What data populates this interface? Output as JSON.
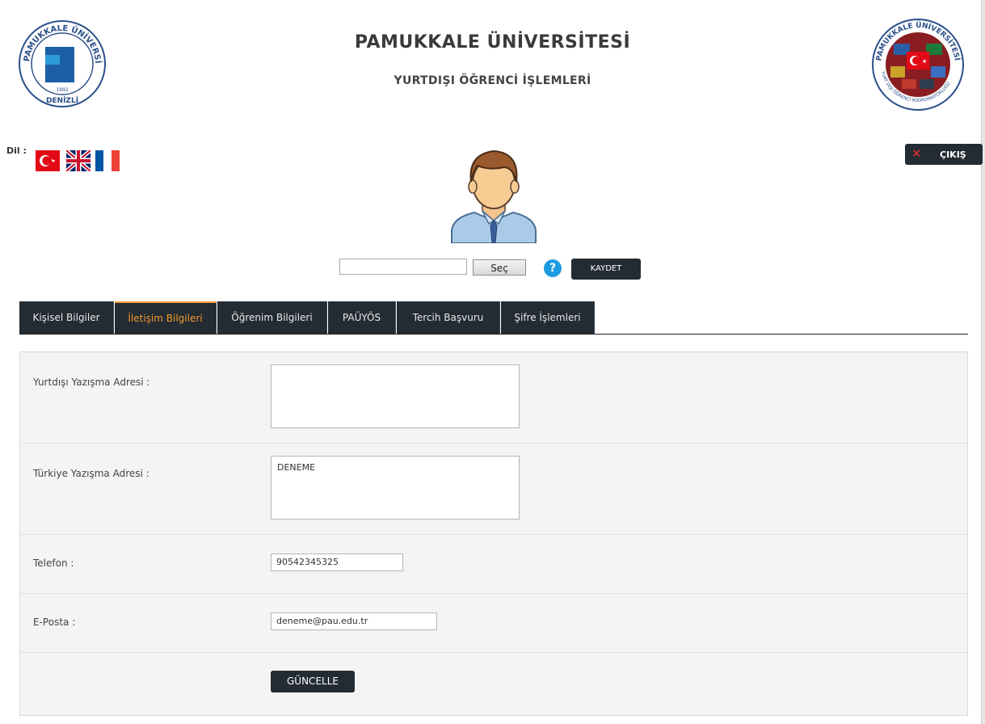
{
  "header": {
    "university_name": "PAMUKKALE ÜNİVERSİTESİ",
    "department": "YURTDIŞI ÖĞRENCİ İŞLEMLERİ",
    "left_logo": {
      "ring_text": "PAMUKKALE ÜNİVERSİTESİ",
      "year": "1992",
      "city": "DENİZLİ"
    },
    "right_logo": {
      "ring_text": "PAMUKKALE ÜNİVERSİTESİ",
      "sub_ring_text": "YURT DIŞI ÖĞRENCİ KOORDİNATÖRLÜĞÜ"
    }
  },
  "language": {
    "label": "Dil :",
    "flags": [
      {
        "name": "turkish-flag-icon",
        "color": "#e30a17"
      },
      {
        "name": "uk-flag-icon",
        "color": "#012169"
      },
      {
        "name": "french-flag-icon",
        "color": "#0055a4"
      }
    ]
  },
  "logout": {
    "label": "ÇIKIŞ",
    "icon": "close-icon",
    "icon_color": "#e82d2d"
  },
  "photo": {
    "choose_label": "Seç",
    "help_icon": "?",
    "save_label": "KAYDET",
    "avatar_icon": "user-avatar-icon"
  },
  "tabs": [
    {
      "label": "Kişisel Bilgiler",
      "active": false
    },
    {
      "label": "İletişim Bilgileri",
      "active": true
    },
    {
      "label": "Öğrenim Bilgileri",
      "active": false
    },
    {
      "label": "PAÜYÖS",
      "active": false
    },
    {
      "label": "Tercih Başvuru",
      "active": false
    },
    {
      "label": "Şifre İşlemleri",
      "active": false
    }
  ],
  "form": {
    "abroad_address_label": "Yurtdışı Yazışma Adresi :",
    "abroad_address_value": "",
    "turkey_address_label": "Türkiye Yazışma Adresi :",
    "turkey_address_value": "DENEME",
    "phone_label": "Telefon :",
    "phone_value": "90542345325",
    "email_label": "E-Posta :",
    "email_value": "deneme@pau.edu.tr",
    "update_label": "GÜNCELLE"
  },
  "colors": {
    "dark_button": "#232b33",
    "active_tab": "#f39a2b",
    "help_blue": "#1e9be0"
  }
}
